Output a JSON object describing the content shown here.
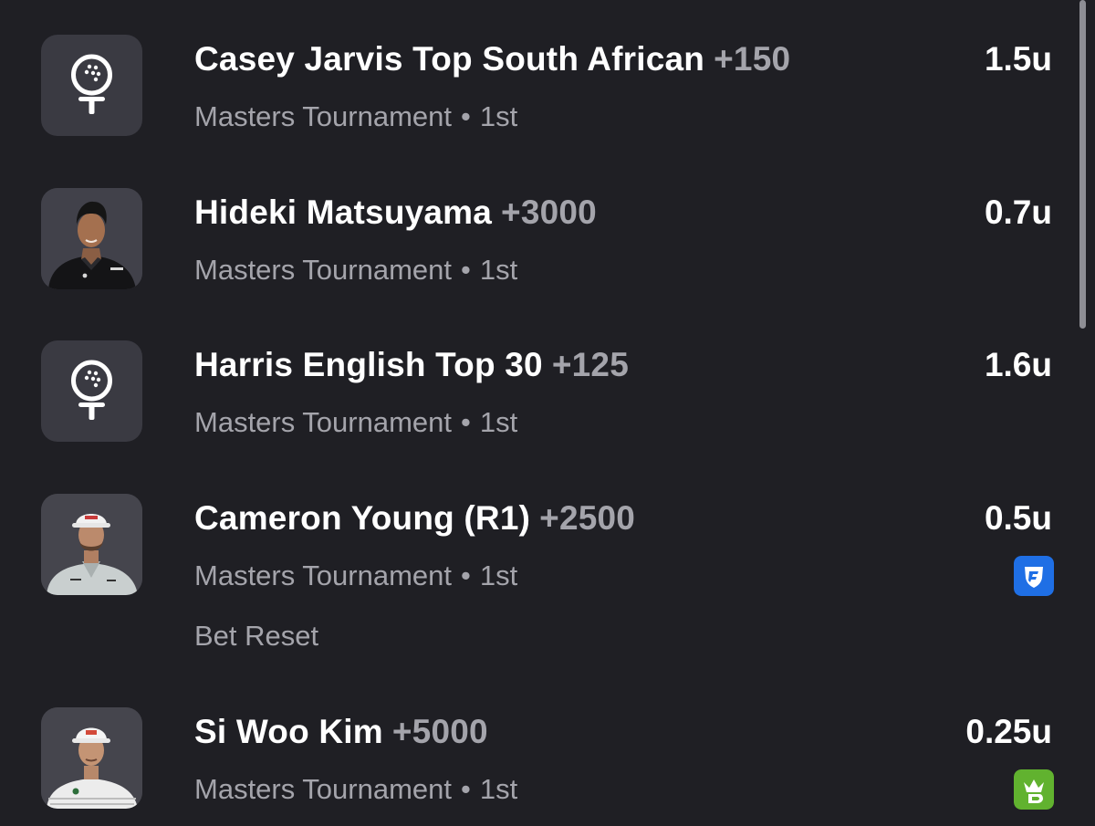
{
  "bets": [
    {
      "title": "Casey Jarvis Top South African",
      "odds": "+150",
      "tournament": "Masters Tournament",
      "separator": "•",
      "position": "1st",
      "units": "1.5u",
      "thumbnail": "golf-ball-tee-icon"
    },
    {
      "title": "Hideki Matsuyama",
      "odds": "+3000",
      "tournament": "Masters Tournament",
      "separator": "•",
      "position": "1st",
      "units": "0.7u",
      "thumbnail": "player-photo"
    },
    {
      "title": "Harris English Top 30",
      "odds": "+125",
      "tournament": "Masters Tournament",
      "separator": "•",
      "position": "1st",
      "units": "1.6u",
      "thumbnail": "golf-ball-tee-icon"
    },
    {
      "title": "Cameron Young (R1)",
      "odds": "+2500",
      "tournament": "Masters Tournament",
      "separator": "•",
      "position": "1st",
      "units": "0.5u",
      "thumbnail": "player-photo",
      "book": "fanduel-shield-icon",
      "note": "Bet Reset"
    },
    {
      "title": "Si Woo Kim",
      "odds": "+5000",
      "tournament": "Masters Tournament",
      "separator": "•",
      "position": "1st",
      "units": "0.25u",
      "thumbnail": "player-photo",
      "book": "draftkings-crown-icon"
    }
  ],
  "colors": {
    "background": "#1f1f24",
    "thumbnail_bg": "#3a3a42",
    "secondary_text": "#a4a4ab",
    "fanduel_blue": "#1f6fe5",
    "draftkings_green": "#61b22f"
  }
}
